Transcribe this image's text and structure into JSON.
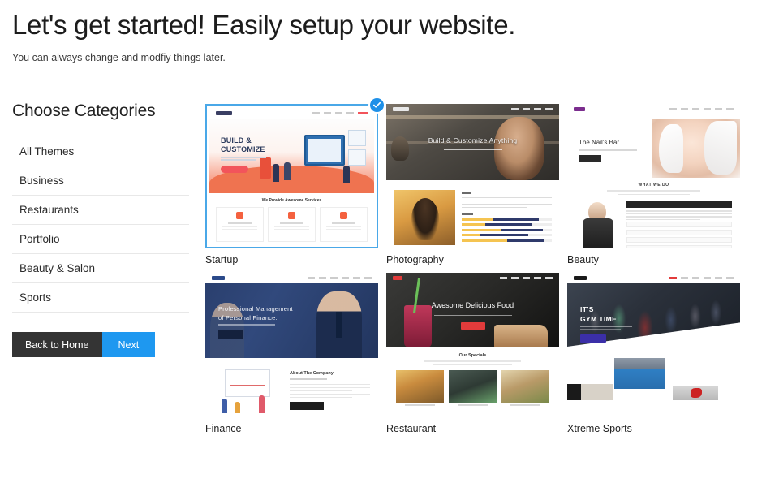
{
  "header": {
    "title": "Let's get started! Easily setup your website.",
    "subtitle": "You can always change and modfiy things later."
  },
  "sidebar": {
    "title": "Choose Categories",
    "categories": [
      {
        "label": "All Themes",
        "active": true
      },
      {
        "label": "Business",
        "active": false
      },
      {
        "label": "Restaurants",
        "active": false
      },
      {
        "label": "Portfolio",
        "active": false
      },
      {
        "label": "Beauty & Salon",
        "active": false
      },
      {
        "label": "Sports",
        "active": false
      }
    ],
    "buttons": {
      "back_label": "Back to Home",
      "next_label": "Next"
    }
  },
  "colors": {
    "accent_blue": "#1e98f0",
    "selection_border": "#4aa8e8",
    "dark_button": "#343434"
  },
  "themes": [
    {
      "id": "startup",
      "label": "Startup",
      "selected": true,
      "preview": {
        "hero_line1": "BUILD &",
        "hero_line2": "CUSTOMIZE",
        "section_title": "We Provide Awesome Services"
      }
    },
    {
      "id": "photography",
      "label": "Photography",
      "selected": false,
      "preview": {
        "hero_title": "Build & Customize Anything"
      }
    },
    {
      "id": "beauty",
      "label": "Beauty",
      "selected": false,
      "preview": {
        "hero_title": "The Nail's Bar",
        "section_title": "WHAT WE DO"
      }
    },
    {
      "id": "finance",
      "label": "Finance",
      "selected": false,
      "preview": {
        "hero_line1": "Professional Management",
        "hero_line2": "of Personal Finance.",
        "section_title": "About The Company"
      }
    },
    {
      "id": "restaurant",
      "label": "Restaurant",
      "selected": false,
      "preview": {
        "hero_title": "Awesome Delicious Food",
        "section_title": "Our Specials"
      }
    },
    {
      "id": "xtreme-sports",
      "label": "Xtreme Sports",
      "selected": false,
      "preview": {
        "hero_line1": "IT'S",
        "hero_line2": "GYM TIME"
      }
    }
  ]
}
